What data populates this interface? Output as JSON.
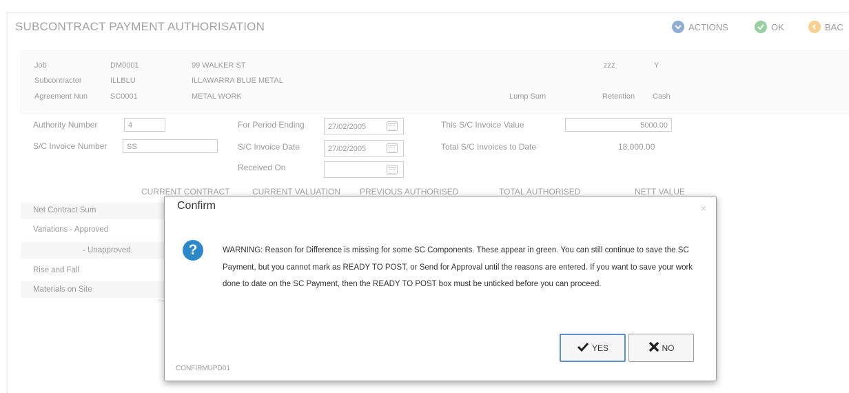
{
  "page": {
    "title": "SUBCONTRACT PAYMENT AUTHORISATION"
  },
  "actions": [
    {
      "label": "ACTIONS",
      "icon": "chevron-down-icon",
      "color": "#1e5aa0"
    },
    {
      "label": "OK",
      "icon": "check-icon",
      "color": "#2ea043"
    },
    {
      "label": "BAC",
      "icon": "back-icon",
      "color": "#f0a020"
    }
  ],
  "info": {
    "job": {
      "label": "Job",
      "code": "DM0001",
      "desc": "99 WALKER ST"
    },
    "subcontractor": {
      "label": "Subcontractor",
      "code": "ILLBLU",
      "desc": "ILLAWARRA BLUE METAL"
    },
    "agreement": {
      "label": "Agreement Nun",
      "code": "SC0001",
      "desc": "METAL WORK"
    },
    "zzz": "zzz",
    "y": "Y",
    "lump_sum": "Lump Sum",
    "retention": "Retention",
    "cash": "Cash"
  },
  "form": {
    "authority_number_label": "Authority Number",
    "authority_number_value": "4",
    "invoice_number_label": "S/C Invoice Number",
    "invoice_number_value": "SS",
    "period_ending_label": "For Period Ending",
    "period_ending_value": "27/02/2005",
    "invoice_date_label": "S/C Invoice Date",
    "invoice_date_value": "27/02/2005",
    "received_on_label": "Received On",
    "received_on_value": "",
    "invoice_value_label": "This S/C Invoice Value",
    "invoice_value_value": "5000.00",
    "total_invoices_label": "Total S/C Invoices to Date",
    "total_invoices_value": "18,000.00"
  },
  "columns": [
    "CURRENT CONTRACT",
    "CURRENT VALUATION",
    "PREVIOUS AUTHORISED",
    "TOTAL AUTHORISED",
    "NETT VALUE"
  ],
  "rows": [
    "Net Contract Sum",
    "Variations -  Approved",
    "- Unapproved",
    "Rise and Fall",
    "Materials on Site"
  ],
  "dialog": {
    "title": "Confirm",
    "close": "×",
    "icon": "question-icon",
    "message": "WARNING: Reason for Difference is missing for some SC Components. These appear in green. You can still continue to save the SC Payment, but you cannot mark as READY TO POST, or Send for Approval until the reasons are entered. If you want to save your work done to date on the SC Payment, then the READY TO POST box must be unticked before you  can proceed.",
    "yes_label": "YES",
    "no_label": "NO",
    "code": "CONFIRMUPD01"
  }
}
